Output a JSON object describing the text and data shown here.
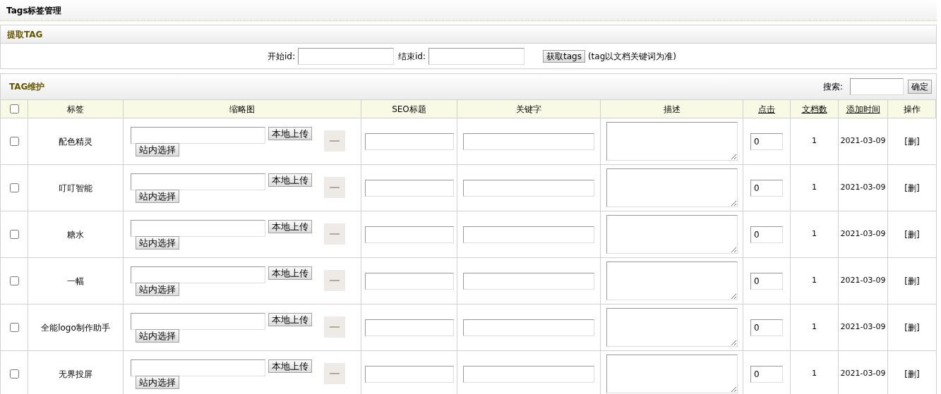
{
  "page_title": "Tags标签管理",
  "fetch_panel": {
    "title": "提取TAG",
    "start_label": "开始id:",
    "end_label": "结束id:",
    "button": "获取tags",
    "note": "(tag以文档关键词为准)"
  },
  "maintain_panel": {
    "title": "TAG维护",
    "search_label": "搜索:",
    "search_button": "确定"
  },
  "table": {
    "select_all": {
      "checked": false
    },
    "columns": [
      {
        "label": "标签",
        "link": false
      },
      {
        "label": "缩略图",
        "link": false
      },
      {
        "label": "SEO标题",
        "link": false
      },
      {
        "label": "关键字",
        "link": false
      },
      {
        "label": "描述",
        "link": false
      },
      {
        "label": "点击",
        "link": true
      },
      {
        "label": "文档数",
        "link": true
      },
      {
        "label": "添加时间",
        "link": true
      },
      {
        "label": "操作",
        "link": false
      }
    ],
    "rows": [
      {
        "checked": false,
        "tag": "配色精灵",
        "upload": "本地上传",
        "pick": "站内选择",
        "clicks": "0",
        "docs": "1",
        "added": "2021-03-09",
        "action": "[删]"
      },
      {
        "checked": false,
        "tag": "叮叮智能",
        "upload": "本地上传",
        "pick": "站内选择",
        "clicks": "0",
        "docs": "1",
        "added": "2021-03-09",
        "action": "[删]"
      },
      {
        "checked": false,
        "tag": "糖水",
        "upload": "本地上传",
        "pick": "站内选择",
        "clicks": "0",
        "docs": "1",
        "added": "2021-03-09",
        "action": "[删]"
      },
      {
        "checked": false,
        "tag": "一幅",
        "upload": "本地上传",
        "pick": "站内选择",
        "clicks": "0",
        "docs": "1",
        "added": "2021-03-09",
        "action": "[删]"
      },
      {
        "checked": false,
        "tag": "全能logo制作助手",
        "upload": "本地上传",
        "pick": "站内选择",
        "clicks": "0",
        "docs": "1",
        "added": "2021-03-09",
        "action": "[删]"
      },
      {
        "checked": false,
        "tag": "无界投屏",
        "upload": "本地上传",
        "pick": "站内选择",
        "clicks": "0",
        "docs": "1",
        "added": "2021-03-09",
        "action": "[删]"
      }
    ]
  }
}
